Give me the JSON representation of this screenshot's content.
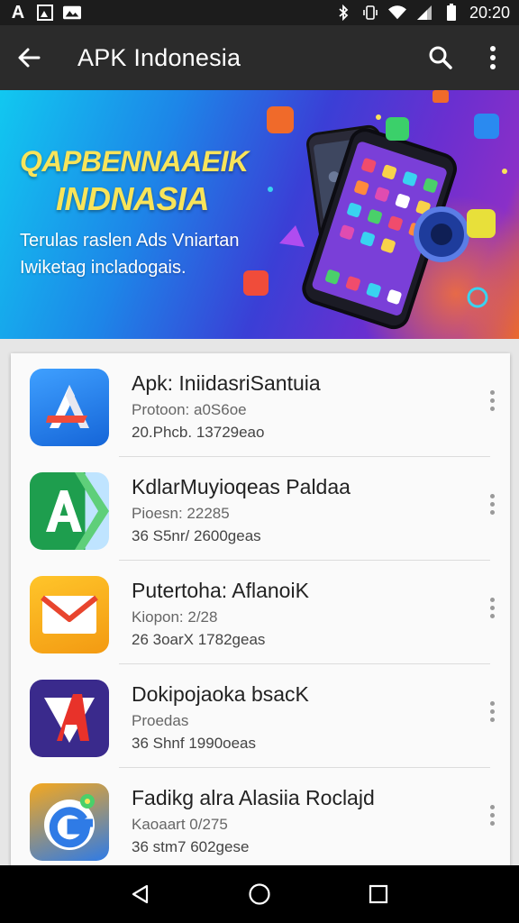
{
  "status_bar": {
    "left_icons": [
      "font-a-icon",
      "image-notification-icon",
      "gallery-notification-icon"
    ],
    "right_icons": [
      "bluetooth-icon",
      "vibrate-icon",
      "wifi-icon",
      "signal-icon",
      "battery-icon"
    ],
    "time": "20:20"
  },
  "app_bar": {
    "title": "APK Indonesia",
    "back_icon": "arrow-left-icon",
    "search_icon": "search-icon",
    "overflow_icon": "more-vert-icon"
  },
  "banner": {
    "headline_line1": "QAPBENNAAEIK",
    "headline_line2": "INDNASIA",
    "subtitle_line1": "Terulas raslen Ads Vniartan",
    "subtitle_line2": "Iwiketag incladogais."
  },
  "apps": [
    {
      "name": "Apk: IniidasriSantuia",
      "meta1": "Protoon: a0S6oe",
      "meta2": "20.Phcb. 13729eao",
      "icon": "app-store-a-icon"
    },
    {
      "name": "KdlarMuyioqeas Paldaa",
      "meta1": "Pioesn: 22285",
      "meta2": "36 S5nr/ 2600geas",
      "icon": "green-a-icon"
    },
    {
      "name": "Putertoha: AflanoiK",
      "meta1": "Kiopon: 2/28",
      "meta2": "26 3oarX 1782geas",
      "icon": "mail-envelope-icon"
    },
    {
      "name": "Dokipojaoka bsacK",
      "meta1": "Proedas",
      "meta2": "36 Shnf 1990oeas",
      "icon": "red-a-icon"
    },
    {
      "name": "Fadikg alra Alasiia Roclajd",
      "meta1": "Kaoaart 0/275",
      "meta2": "36 stm7 602gese",
      "icon": "g-flower-icon"
    }
  ],
  "nav_bar": {
    "back_icon": "nav-back-triangle-icon",
    "home_icon": "nav-home-circle-icon",
    "recents_icon": "nav-recents-square-icon"
  },
  "colors": {
    "status_bar": "#1c1c1c",
    "app_bar": "#2b2b2b",
    "banner_accent": "#f8e45a",
    "list_background": "#fafafa"
  }
}
